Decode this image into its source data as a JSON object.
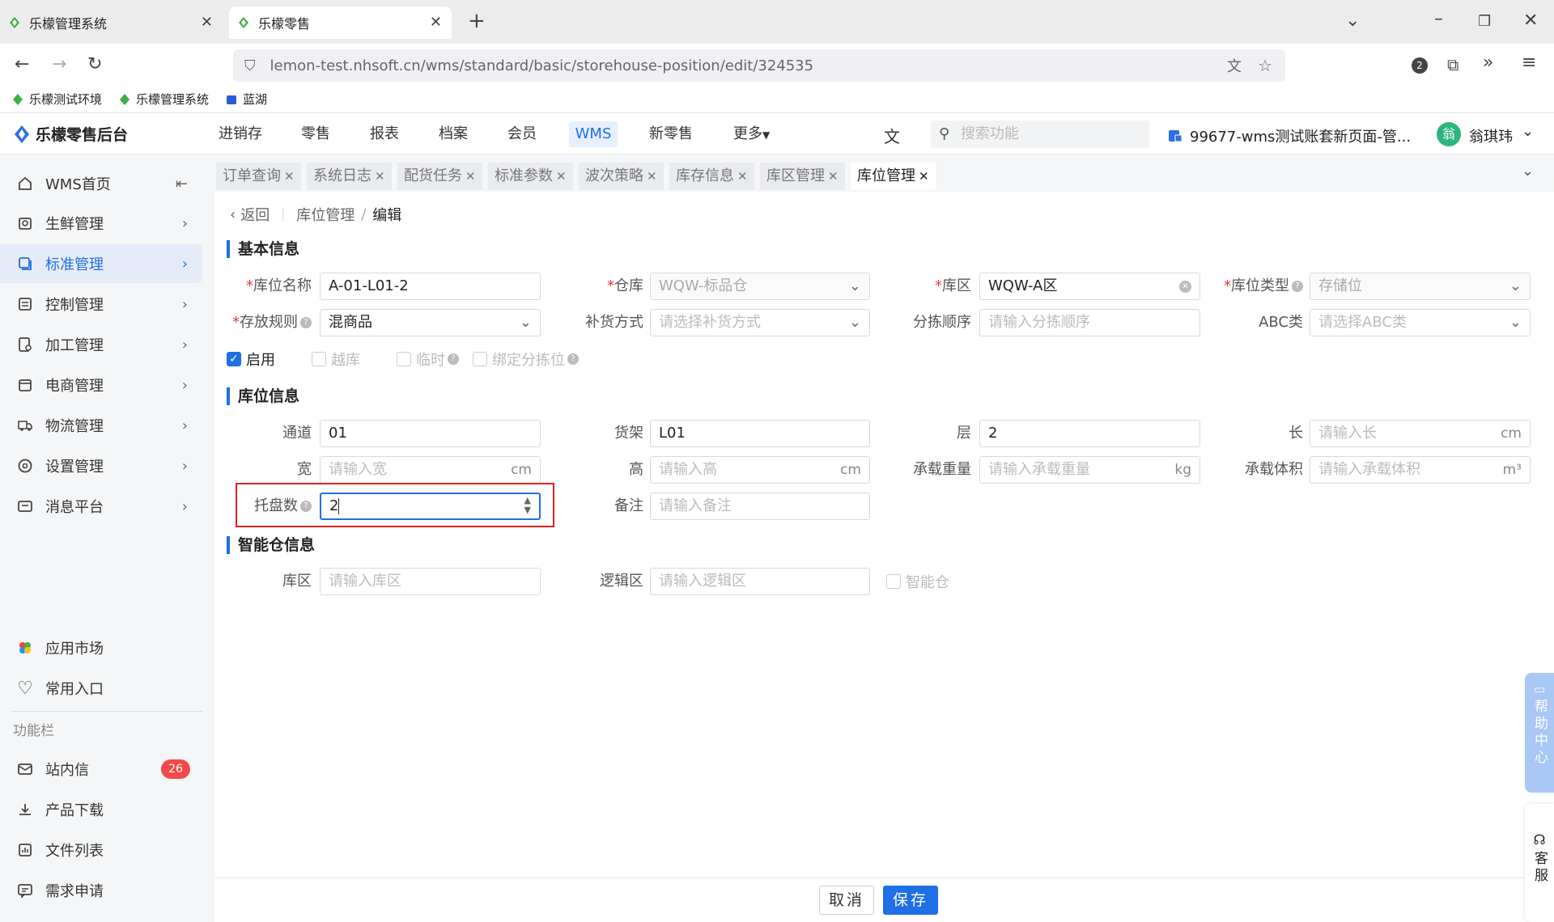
{
  "browser": {
    "tabs": [
      {
        "title": "乐檬管理系统"
      },
      {
        "title": "乐檬零售"
      }
    ],
    "url": "lemon-test.nhsoft.cn/wms/standard/basic/storehouse-position/edit/324535",
    "ext_badge": "2",
    "bookmarks": [
      "乐檬测试环境",
      "乐檬管理系统",
      "蓝湖"
    ]
  },
  "app": {
    "logo": "乐檬零售后台",
    "nav": [
      "进销存",
      "零售",
      "报表",
      "档案",
      "会员",
      "WMS",
      "新零售",
      "更多"
    ],
    "search_placeholder": "搜索功能",
    "account": "99677-wms测试账套新页面-管...",
    "user_avatar": "翁",
    "user_name": "翁琪玮"
  },
  "sidebar": {
    "items": [
      {
        "label": "WMS首页",
        "icon": "home-icon"
      },
      {
        "label": "生鲜管理",
        "icon": "fresh-icon"
      },
      {
        "label": "标准管理",
        "icon": "standard-icon"
      },
      {
        "label": "控制管理",
        "icon": "control-icon"
      },
      {
        "label": "加工管理",
        "icon": "process-icon"
      },
      {
        "label": "电商管理",
        "icon": "store-icon"
      },
      {
        "label": "物流管理",
        "icon": "truck-icon"
      },
      {
        "label": "设置管理",
        "icon": "settings-icon"
      },
      {
        "label": "消息平台",
        "icon": "message-icon"
      }
    ],
    "bottom": [
      {
        "label": "应用市场"
      },
      {
        "label": "常用入口"
      }
    ],
    "section_title": "功能栏",
    "tools": [
      {
        "label": "站内信",
        "badge": "26"
      },
      {
        "label": "产品下载"
      },
      {
        "label": "文件列表"
      },
      {
        "label": "需求申请"
      }
    ]
  },
  "page_tabs": [
    "订单查询",
    "系统日志",
    "配货任务",
    "标准参数",
    "波次策略",
    "库存信息",
    "库区管理",
    "库位管理"
  ],
  "breadcrumb": {
    "back": "返回",
    "parent": "库位管理",
    "sep": "/",
    "current": "编辑"
  },
  "basic": {
    "title": "基本信息",
    "name_label": "库位名称",
    "name_value": "A-01-L01-2",
    "warehouse_label": "仓库",
    "warehouse_value": "WQW-标品仓",
    "zone_label": "库区",
    "zone_value": "WQW-A区",
    "type_label": "库位类型",
    "type_value": "存储位",
    "rule_label": "存放规则",
    "rule_value": "混商品",
    "replenish_label": "补货方式",
    "replenish_placeholder": "请选择补货方式",
    "sort_label": "分拣顺序",
    "sort_placeholder": "请输入分拣顺序",
    "abc_label": "ABC类",
    "abc_placeholder": "请选择ABC类",
    "checks": [
      "启用",
      "越库",
      "临时",
      "绑定分拣位"
    ]
  },
  "position": {
    "title": "库位信息",
    "aisle_label": "通道",
    "aisle_value": "01",
    "shelf_label": "货架",
    "shelf_value": "L01",
    "layer_label": "层",
    "layer_value": "2",
    "length_label": "长",
    "length_placeholder": "请输入长",
    "length_unit": "cm",
    "width_label": "宽",
    "width_placeholder": "请输入宽",
    "width_unit": "cm",
    "height_label": "高",
    "height_placeholder": "请输入高",
    "height_unit": "cm",
    "weight_label": "承载重量",
    "weight_placeholder": "请输入承载重量",
    "weight_unit": "kg",
    "volume_label": "承载体积",
    "volume_placeholder": "请输入承载体积",
    "volume_unit": "m³",
    "pallet_label": "托盘数",
    "pallet_value": "2",
    "remark_label": "备注",
    "remark_placeholder": "请输入备注"
  },
  "smart": {
    "title": "智能仓信息",
    "zone_label": "库区",
    "zone_placeholder": "请输入库区",
    "logic_label": "逻辑区",
    "logic_placeholder": "请输入逻辑区",
    "smart_check": "智能仓"
  },
  "footer": {
    "cancel": "取消",
    "save": "保存"
  },
  "float": {
    "help": "帮助中心",
    "service": "客服"
  },
  "colors": {
    "accent": "#1f6fe5",
    "highlight": "#e02020",
    "badge": "#f5494a"
  }
}
